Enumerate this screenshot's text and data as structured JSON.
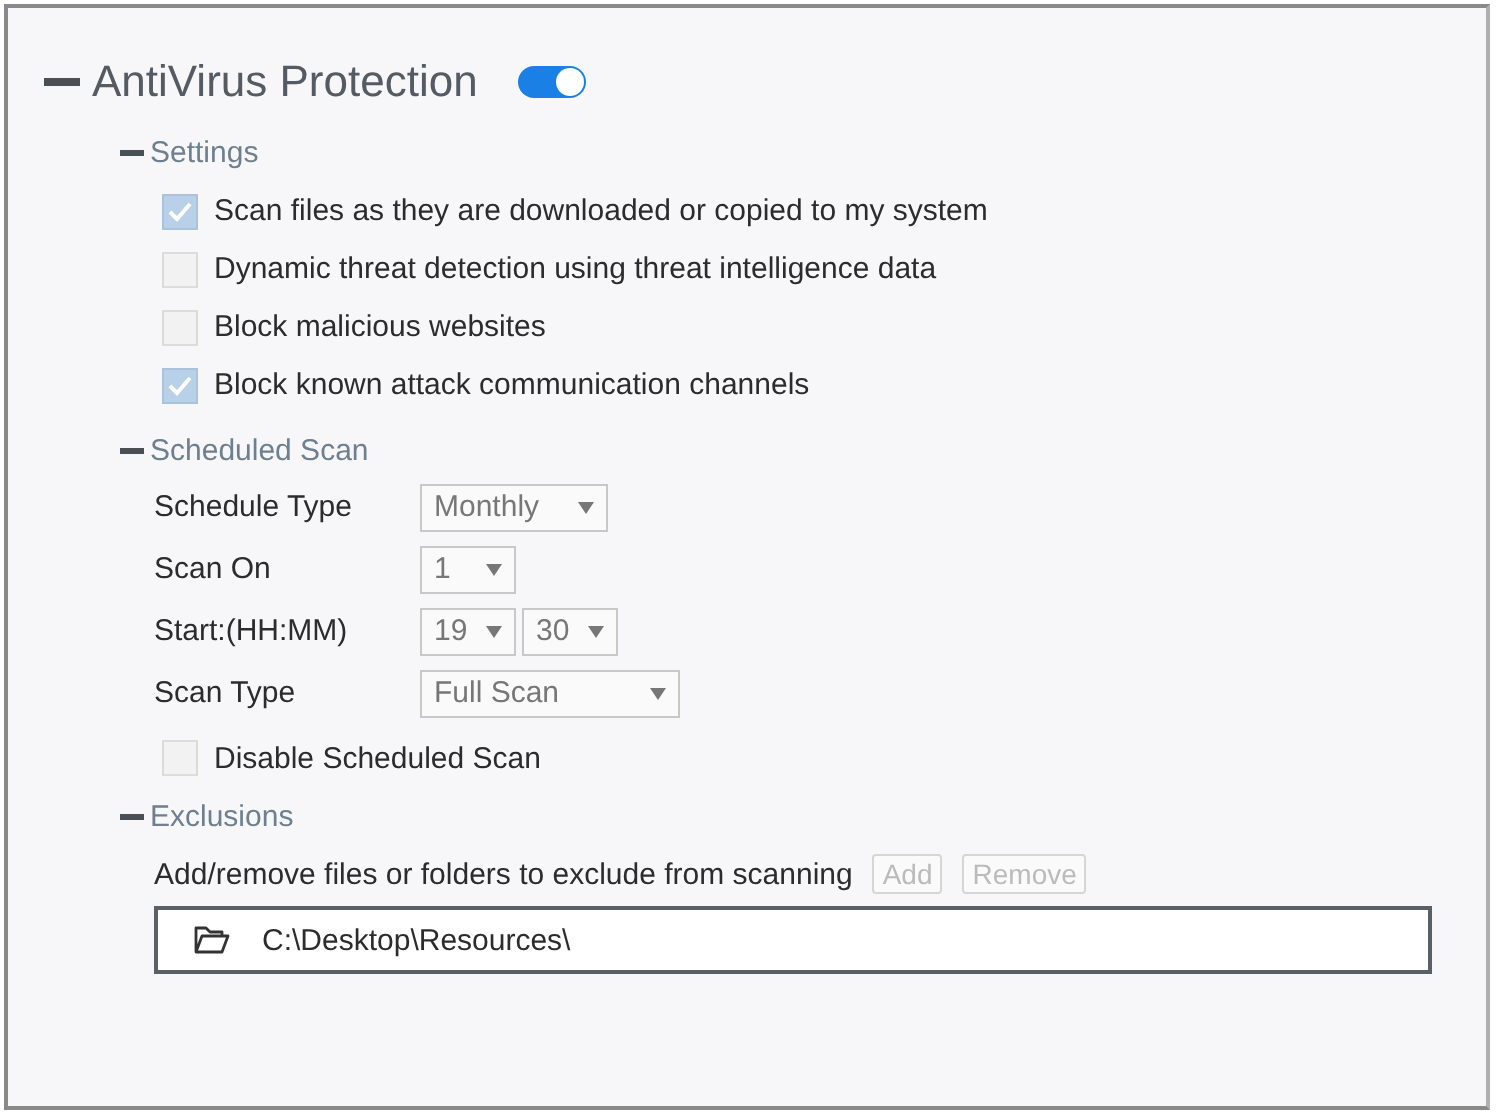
{
  "panel": {
    "title": "AntiVirus Protection",
    "expanded": true,
    "on": true
  },
  "settings": {
    "title": "Settings",
    "expanded": true,
    "options": [
      {
        "label": "Scan files as they are downloaded or copied to my system",
        "checked": true
      },
      {
        "label": "Dynamic threat detection using threat intelligence data",
        "checked": false
      },
      {
        "label": "Block malicious websites",
        "checked": false
      },
      {
        "label": "Block known attack communication channels",
        "checked": true
      }
    ]
  },
  "scheduled_scan": {
    "title": "Scheduled Scan",
    "expanded": true,
    "fields": [
      {
        "label": "Schedule Type",
        "selects": [
          "Monthly"
        ],
        "kind": "medium"
      },
      {
        "label": "Scan On",
        "selects": [
          "1"
        ],
        "kind": "small"
      },
      {
        "label": "Start:(HH:MM)",
        "selects": [
          "19",
          "30"
        ],
        "kind": "small"
      },
      {
        "label": "Scan Type",
        "selects": [
          "Full Scan"
        ],
        "kind": "wide"
      }
    ],
    "disable": {
      "label": "Disable Scheduled Scan",
      "checked": false
    }
  },
  "exclusions": {
    "title": "Exclusions",
    "expanded": true,
    "description": "Add/remove files or folders to exclude from scanning",
    "buttons": [
      {
        "label": "Add",
        "disabled": true
      },
      {
        "label": "Remove",
        "disabled": true
      }
    ],
    "items": [
      "C:\\Desktop\\Resources\\"
    ]
  }
}
